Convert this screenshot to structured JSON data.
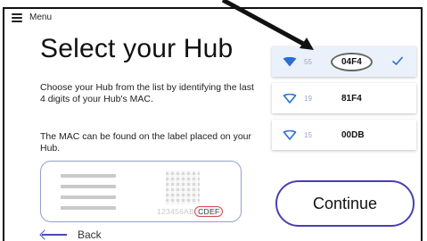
{
  "menu": {
    "label": "Menu"
  },
  "page": {
    "title": "Select your Hub",
    "description": "Choose your Hub from the list by identifying the last 4 digits of your Hub's MAC.",
    "hint": "The MAC can be found on the label placed on your Hub."
  },
  "label_card": {
    "mac_prefix": "123456AB",
    "mac_suffix": "CDEF"
  },
  "hubs": [
    {
      "signal": "55",
      "id": "04F4",
      "selected": true
    },
    {
      "signal": "19",
      "id": "81F4",
      "selected": false
    },
    {
      "signal": "15",
      "id": "00DB",
      "selected": false
    }
  ],
  "buttons": {
    "continue": "Continue",
    "back": "Back"
  },
  "colors": {
    "accent": "#4a3fb5",
    "wifi": "#2a6fd0",
    "selected_row": "#eaf1fb"
  },
  "icons": {
    "menu": "hamburger-icon",
    "wifi": "wifi-icon",
    "check": "check-icon",
    "back": "arrow-left-icon"
  }
}
